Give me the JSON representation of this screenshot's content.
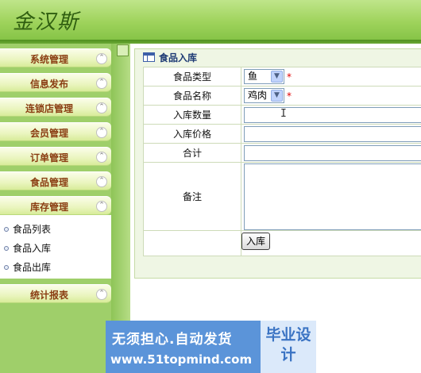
{
  "header": {
    "logo": "金汉斯"
  },
  "sidebar": {
    "menus": [
      {
        "label": "系统管理"
      },
      {
        "label": "信息发布"
      },
      {
        "label": "连锁店管理"
      },
      {
        "label": "会员管理"
      },
      {
        "label": "订单管理"
      },
      {
        "label": "食品管理"
      },
      {
        "label": "库存管理"
      },
      {
        "label": "统计报表"
      }
    ],
    "toggle_icon": "chevron-up-icon",
    "submenu": [
      {
        "label": "食品列表"
      },
      {
        "label": "食品入库"
      },
      {
        "label": "食品出库"
      }
    ]
  },
  "panel": {
    "title": "食品入库",
    "title_icon": "table-icon"
  },
  "form": {
    "type_label": "食品类型",
    "type_value": "鱼",
    "name_label": "食品名称",
    "name_value": "鸡肉",
    "required_mark": "*",
    "quantity_label": "入库数量",
    "quantity_value": "",
    "price_label": "入库价格",
    "price_value": "",
    "total_label": "合计",
    "total_value": "",
    "remark_label": "备注",
    "remark_value": "",
    "submit_label": "入库"
  },
  "cursor": "I",
  "watermark": {
    "line1": "无须担心.自动发货",
    "line2": "www.51topmind.com",
    "badge": "毕业设计"
  },
  "colors": {
    "header": "#9fd35c",
    "sidebar": "#9fcf6a",
    "menu_text": "#8a3d12",
    "required": "#e00000"
  }
}
